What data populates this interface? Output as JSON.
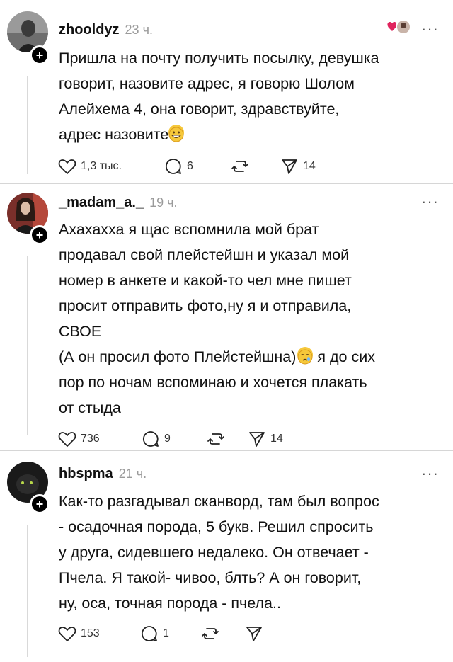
{
  "posts": [
    {
      "username": "zhooldyz",
      "time": "23 ч.",
      "more": "···",
      "lines": [
        "Пришла на почту получить посылку, девушка",
        "говорит, назовите адрес, я говорю Шолом",
        "Алейхема 4, она говорит, здравствуйте,",
        "адрес назовите"
      ],
      "likes": "1,3 тыс.",
      "comments": "6",
      "shares": "14"
    },
    {
      "username": "_madam_a._",
      "time": "19 ч.",
      "more": "···",
      "lines": [
        "Ахахахха я щас вспомнила мой брат",
        "продавал свой плейстейшн и указал мой",
        "номер в анкете и какой-то чел мне пишет",
        "просит отправить фото,ну я и отправила,",
        "СВОЕ",
        "(А он просил фото Плейстейшна)",
        "я до сих",
        "пор по ночам вспоминаю и хочется плакать",
        "от стыда"
      ],
      "likes": "736",
      "comments": "9",
      "shares": "14"
    },
    {
      "username": "hbspma",
      "time": "21 ч.",
      "more": "···",
      "lines": [
        "Как-то разгадывал сканворд, там был вопрос",
        "- осадочная порода, 5 букв. Решил спросить",
        "у друга, сидевшего недалеко. Он отвечает -",
        "Пчела. Я такой- чивоо, блть? А он говорит,",
        "ну, оса, точная порода - пчела.."
      ],
      "likes": "153",
      "comments": "1",
      "shares": ""
    }
  ],
  "icons": {
    "like": "heart-icon",
    "comment": "comment-icon",
    "repost": "repost-icon",
    "share": "send-icon",
    "plus": "+"
  },
  "colors": {
    "text": "#111111",
    "muted": "#9a9a9a",
    "separator": "#d6d6d6",
    "emoji": "#f6c83b"
  }
}
